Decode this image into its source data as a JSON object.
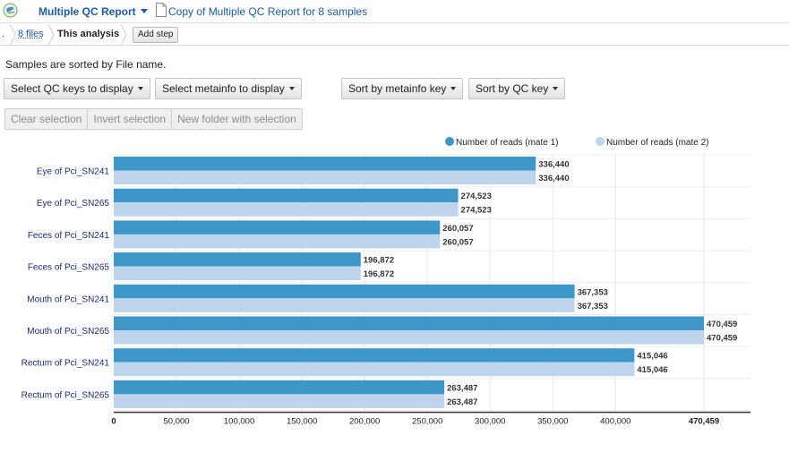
{
  "header": {
    "report_title": "Multiple QC Report",
    "copy_link": "Copy of Multiple QC Report for 8 samples"
  },
  "breadcrumb": {
    "prefix": ".",
    "files": "8 files",
    "current": "This analysis",
    "add_step": "Add step"
  },
  "sorted_text": "Samples are sorted by File name.",
  "toolbar": {
    "select_qc_keys": "Select QC keys to display",
    "select_metainfo": "Select metainfo to display",
    "sort_by_metainfo": "Sort by metainfo key",
    "sort_by_qc": "Sort by QC key"
  },
  "selection": {
    "clear": "Clear selection",
    "invert": "Invert selection",
    "new_folder": "New folder with selection"
  },
  "colors": {
    "series1": "#3d97c9",
    "series2": "#bed3ec",
    "link": "#1a5aa6",
    "category_text": "#1a2a7a"
  },
  "chart_data": {
    "type": "bar",
    "orientation": "horizontal",
    "categories": [
      "Eye of Pci_SN241",
      "Eye of Pci_SN265",
      "Feces of Pci_SN241",
      "Feces of Pci_SN265",
      "Mouth of Pci_SN241",
      "Mouth of Pci_SN265",
      "Rectum of Pci_SN241",
      "Rectum of Pci_SN265"
    ],
    "series": [
      {
        "name": "Number of reads (mate 1)",
        "values": [
          336440,
          274523,
          260057,
          196872,
          367353,
          470459,
          415046,
          263487
        ],
        "labels": [
          "336,440",
          "274,523",
          "260,057",
          "196,872",
          "367,353",
          "470,459",
          "415,046",
          "263,487"
        ]
      },
      {
        "name": "Number of reads (mate 2)",
        "values": [
          336440,
          274523,
          260057,
          196872,
          367353,
          470459,
          415046,
          263487
        ],
        "labels": [
          "336,440",
          "274,523",
          "260,057",
          "196,872",
          "367,353",
          "470,459",
          "415,046",
          "263,487"
        ]
      }
    ],
    "xlim": [
      0,
      470459
    ],
    "x_ticks": [
      0,
      50000,
      100000,
      150000,
      200000,
      250000,
      300000,
      350000,
      400000
    ],
    "x_tick_labels": [
      "0",
      "50,000",
      "100,000",
      "150,000",
      "200,000",
      "250,000",
      "300,000",
      "350,000",
      "400,000"
    ],
    "x_max_label": "470,459",
    "grid": true,
    "legend_position": "top-right"
  }
}
